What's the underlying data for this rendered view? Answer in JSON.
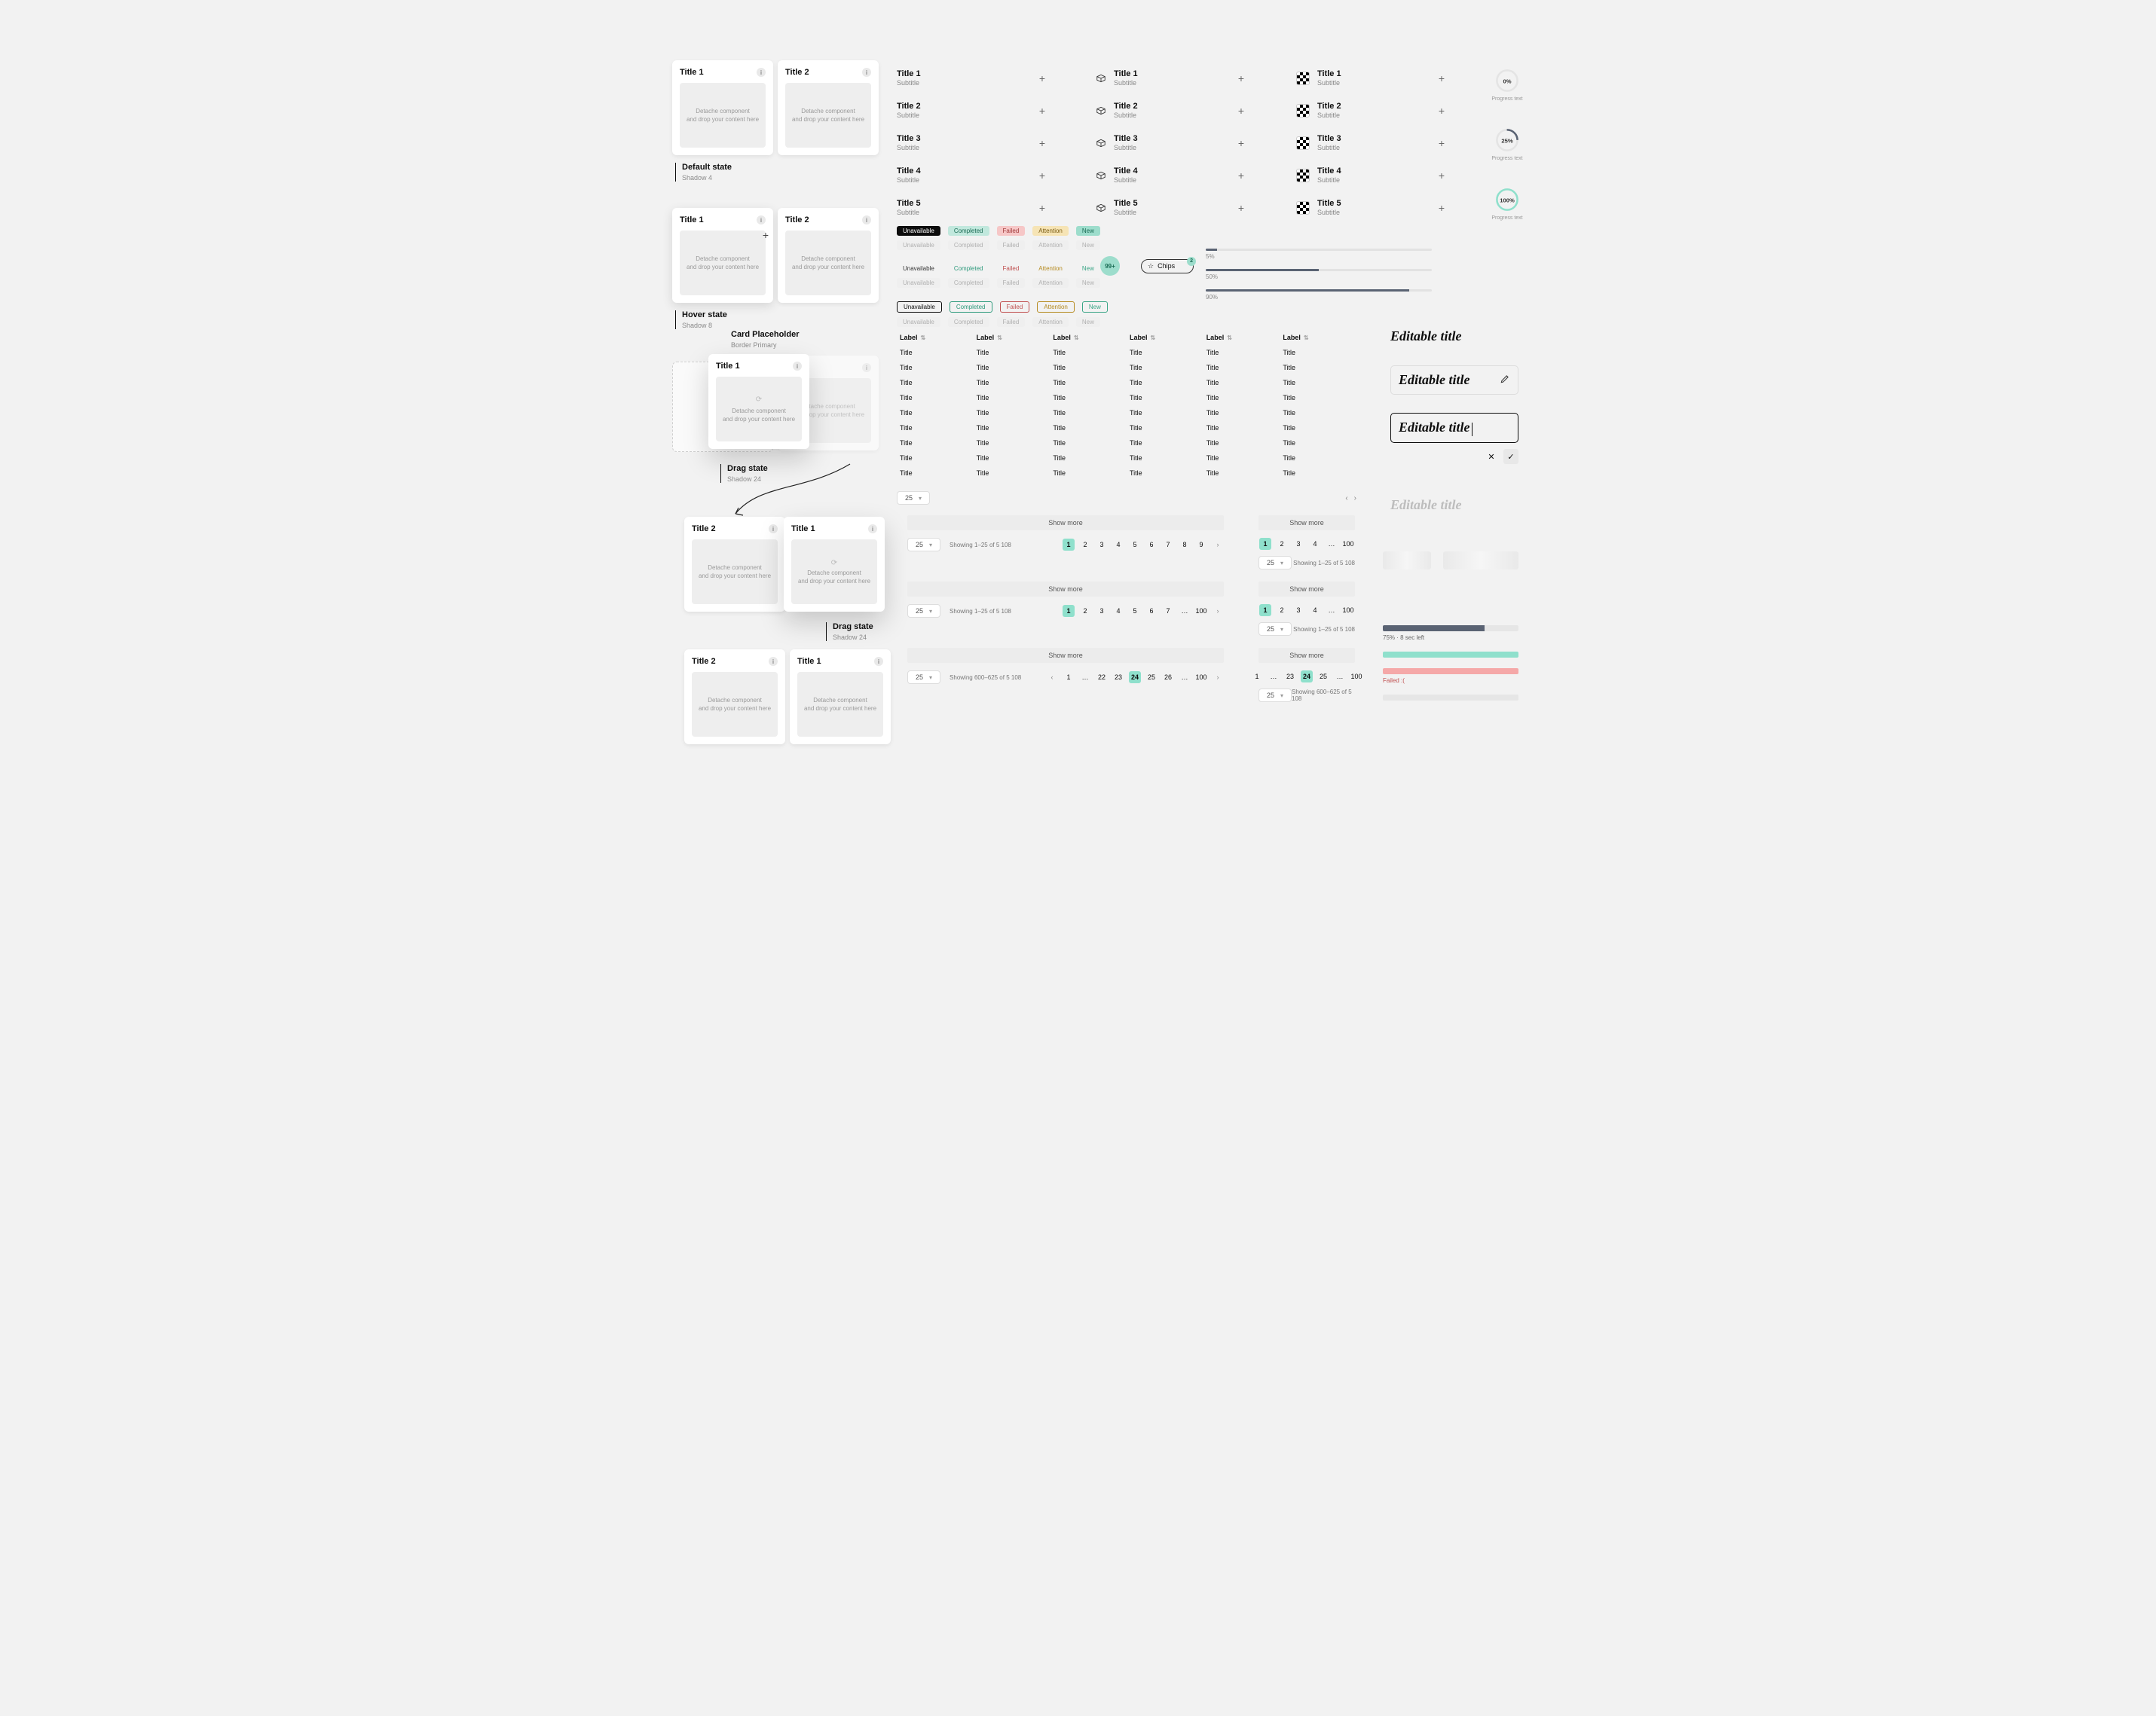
{
  "card": {
    "placeholder_l1": "Detache component",
    "placeholder_l2": "and drop your content here",
    "info_glyph": "i",
    "titles": {
      "t1": "Title 1",
      "t2": "Title 2"
    }
  },
  "states": {
    "default": {
      "label": "Default state",
      "sub": "Shadow 4"
    },
    "hover": {
      "label": "Hover state",
      "sub": "Shadow 8"
    },
    "placeholder": {
      "label": "Card Placeholder",
      "sub": "Border Primary"
    },
    "drag1": {
      "label": "Drag state",
      "sub": "Shadow 24"
    },
    "drag2": {
      "label": "Drag state",
      "sub": "Shadow 24"
    }
  },
  "title_list": {
    "items": [
      {
        "title": "Title 1",
        "subtitle": "Subtitle"
      },
      {
        "title": "Title 2",
        "subtitle": "Subtitle"
      },
      {
        "title": "Title 3",
        "subtitle": "Subtitle"
      },
      {
        "title": "Title 4",
        "subtitle": "Subtitle"
      },
      {
        "title": "Title 5",
        "subtitle": "Subtitle"
      }
    ]
  },
  "tags": {
    "labels": {
      "unavailable": "Unavailable",
      "completed": "Completed",
      "failed": "Failed",
      "attention": "Attention",
      "new": "New"
    },
    "counter": "99+",
    "chip_label": "Chips",
    "chip_badge": "2"
  },
  "progress_bars": [
    {
      "pct": 5,
      "label": "5%"
    },
    {
      "pct": 50,
      "label": "50%"
    },
    {
      "pct": 90,
      "label": "90%"
    }
  ],
  "rings": [
    {
      "pct": 0,
      "label": "0%"
    },
    {
      "pct": 25,
      "label": "25%"
    },
    {
      "pct": 100,
      "label": "100%"
    }
  ],
  "ring_caption": "Progress text",
  "table": {
    "header_label": "Label",
    "cell_label": "Title",
    "rows": 9,
    "cols": 6,
    "page_size": "25"
  },
  "editable": {
    "text": "Editable title"
  },
  "skeleton": {},
  "loading": {
    "bar1": {
      "pct": 75,
      "caption": "75% · 8 sec left"
    },
    "bar2": {
      "pct": 100
    },
    "bar3": {
      "pct": 100,
      "caption": "Failed :("
    }
  },
  "pag_common": {
    "show_more": "Show more",
    "page_size": "25",
    "showing_a": "Showing 1–25 of 5 108",
    "showing_b": "Showing 600–625 of 5 108"
  },
  "pagA": {
    "pages": [
      "1",
      "2",
      "3",
      "4",
      "5",
      "6",
      "7",
      "8",
      "9"
    ]
  },
  "pagB": {
    "pages": [
      "1",
      "2",
      "3",
      "4",
      "5",
      "6",
      "7",
      "…",
      "100"
    ]
  },
  "pagC": {
    "pages": [
      "1",
      "…",
      "22",
      "23",
      "24",
      "25",
      "26",
      "…",
      "100"
    ],
    "active": "24"
  },
  "pagSideA": {
    "pages": [
      "1",
      "2",
      "3",
      "4",
      "…",
      "100"
    ]
  },
  "pagSideB": {
    "pages": [
      "1",
      "2",
      "3",
      "4",
      "…",
      "100"
    ]
  },
  "pagSideC": {
    "pages": [
      "1",
      "…",
      "23",
      "24",
      "25",
      "…",
      "100"
    ],
    "active": "24"
  }
}
